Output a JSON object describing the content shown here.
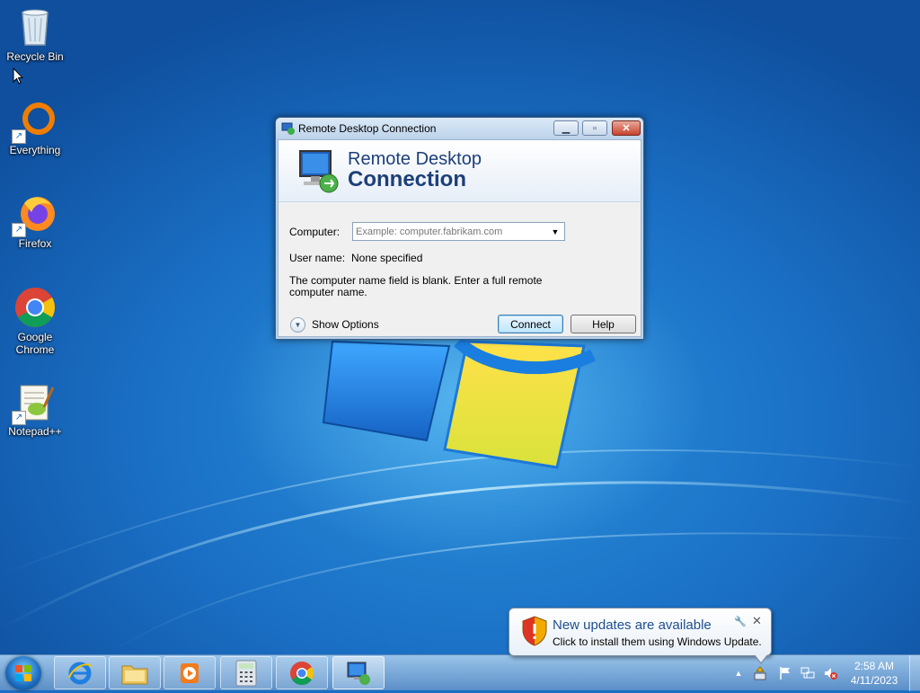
{
  "desktop": {
    "icons": [
      {
        "label": "Recycle Bin",
        "icon": "recycle-bin-icon"
      },
      {
        "label": "Everything",
        "icon": "everything-icon"
      },
      {
        "label": "Firefox",
        "icon": "firefox-icon"
      },
      {
        "label": "Google Chrome",
        "icon": "chrome-icon"
      },
      {
        "label": "Notepad++",
        "icon": "notepadpp-icon"
      }
    ]
  },
  "dialog": {
    "title": "Remote Desktop Connection",
    "banner_line1": "Remote Desktop",
    "banner_line2": "Connection",
    "computer_label": "Computer:",
    "computer_value": "",
    "computer_placeholder": "Example: computer.fabrikam.com",
    "username_label": "User name:",
    "username_value": "None specified",
    "message": "The computer name field is blank. Enter a full remote computer name.",
    "show_options_label": "Show Options",
    "connect_label": "Connect",
    "help_label": "Help",
    "caption_buttons": {
      "minimize": "minimize-icon",
      "maximize": "maximize-icon",
      "close": "close-icon"
    }
  },
  "notification": {
    "title": "New updates are available",
    "body": "Click to install them using Windows Update.",
    "icon": "shield-warning-icon"
  },
  "taskbar": {
    "pinned": [
      {
        "name": "internet-explorer",
        "icon": "ie-icon"
      },
      {
        "name": "windows-explorer",
        "icon": "folder-icon"
      },
      {
        "name": "media-player",
        "icon": "media-player-icon"
      },
      {
        "name": "calculator",
        "icon": "calculator-icon"
      },
      {
        "name": "chrome",
        "icon": "chrome-icon"
      },
      {
        "name": "remote-desktop",
        "icon": "remote-desktop-icon",
        "active": true
      }
    ],
    "clock": {
      "time": "2:58 AM",
      "date": "4/11/2023"
    }
  },
  "colors": {
    "desktop_blue": "#1a6fc4",
    "banner_text": "#1d3f7a",
    "balloon_title": "#1d4f91",
    "close_red": "#c7432e"
  }
}
